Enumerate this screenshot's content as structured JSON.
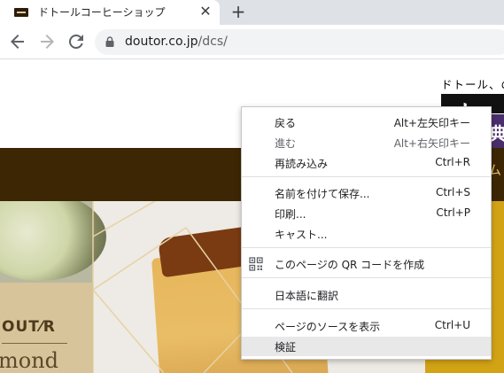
{
  "browser": {
    "tab_title": "ドトールコーヒーショップ",
    "url_host": "doutor.co.jp",
    "url_path": "/dcs/"
  },
  "page": {
    "tagline": "ドトール、の",
    "bar_fragment": "ム",
    "card_brand": "OUT⁄R",
    "card_word": "mond",
    "badge": "典"
  },
  "menu": {
    "back": {
      "label": "戻る",
      "shortcut": "Alt+左矢印キー"
    },
    "forward": {
      "label": "進む",
      "shortcut": "Alt+右矢印キー"
    },
    "reload": {
      "label": "再読み込み",
      "shortcut": "Ctrl+R"
    },
    "save_as": {
      "label": "名前を付けて保存...",
      "shortcut": "Ctrl+S"
    },
    "print": {
      "label": "印刷...",
      "shortcut": "Ctrl+P"
    },
    "cast": {
      "label": "キャスト..."
    },
    "qr": {
      "label": "このページの QR コードを作成"
    },
    "translate": {
      "label": "日本語に翻訳"
    },
    "view_source": {
      "label": "ページのソースを表示",
      "shortcut": "Ctrl+U"
    },
    "inspect": {
      "label": "検証"
    }
  },
  "colors": {
    "brown_bar": "#3d2603",
    "menu_highlight": "#e8e8e9"
  }
}
